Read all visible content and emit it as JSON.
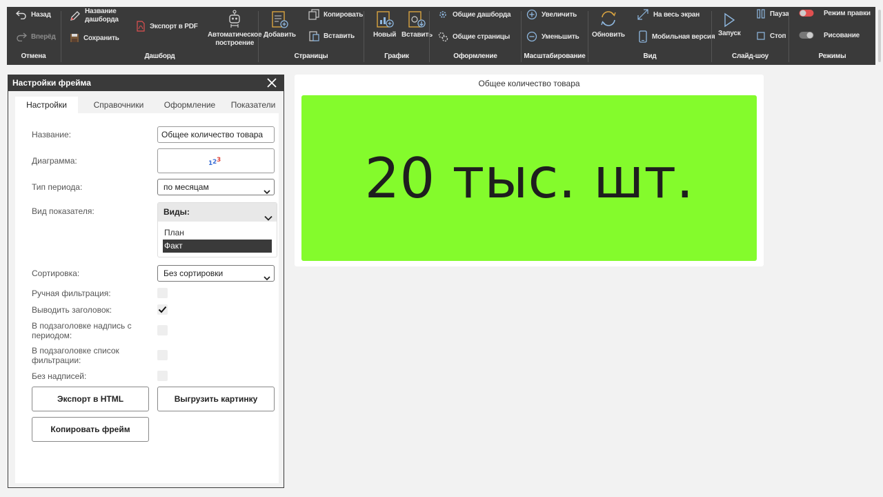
{
  "ribbon": {
    "groups": {
      "undo": "Отмена",
      "dashboard": "Дашборд",
      "pages": "Страницы",
      "chart": "График",
      "design": "Оформление",
      "zoom": "Масштабирование",
      "view": "Вид",
      "slideshow": "Слайд-шоу",
      "modes": "Режимы"
    },
    "back": "Назад",
    "forward": "Вперёд",
    "dashboard_name_line1": "Название",
    "dashboard_name_line2": "дашборда",
    "save": "Сохранить",
    "export_pdf": "Экспорт в PDF",
    "auto_build_line1": "Автоматическое",
    "auto_build_line2": "построение",
    "add": "Добавить",
    "copy": "Копировать",
    "paste": "Вставить",
    "new_chart": "Новый",
    "paste_chart": "Вставить",
    "shared_dashboards": "Общие дашборда",
    "shared_pages": "Общие страницы",
    "zoom_in": "Увеличить",
    "zoom_out": "Уменьшить",
    "refresh": "Обновить",
    "fullscreen": "На весь экран",
    "mobile": "Мобильная версия",
    "start": "Запуск",
    "pause": "Пауза",
    "stop": "Стоп",
    "edit_mode": "Режим правки",
    "draw_mode": "Рисование",
    "colors": {
      "bg": "#3a3a3a",
      "accent_red": "#e05050"
    }
  },
  "panel": {
    "title": "Настройки фрейма",
    "tabs": [
      "Настройки",
      "Справочники",
      "Оформление",
      "Показатели"
    ],
    "active_tab": "Настройки",
    "labels": {
      "name": "Название:",
      "chart": "Диаграмма:",
      "period_type": "Тип периода:",
      "indicator_kind": "Вид показателя:",
      "sort": "Сортировка:",
      "manual_filter": "Ручная фильтрация:",
      "show_header": "Выводить заголовок:",
      "subheader_period_line1": "В подзаголовке надпись с",
      "subheader_period_line2": "периодом:",
      "subheader_filters_line1": "В подзаголовке список",
      "subheader_filters_line2": "фильтрации:",
      "no_captions": "Без надписей:"
    },
    "name_value": "Общее количество товара",
    "chart_icon": "number-chart-icon",
    "period_value": "по месяцам",
    "indicator_head": "Виды:",
    "indicator_options": [
      {
        "label": "План",
        "selected": false
      },
      {
        "label": "Факт",
        "selected": true
      }
    ],
    "sort_value": "Без сортировки",
    "checks": {
      "manual_filter": false,
      "show_header": true,
      "subheader_period": false,
      "subheader_filters": false,
      "no_captions": false
    },
    "buttons": {
      "export_html": "Экспорт в HTML",
      "export_image": "Выгрузить картинку",
      "copy_frame": "Копировать фрейм"
    }
  },
  "frame": {
    "title": "Общее количество товара",
    "value": "20 тыс. шт.",
    "bg_color": "#84fb2c"
  }
}
